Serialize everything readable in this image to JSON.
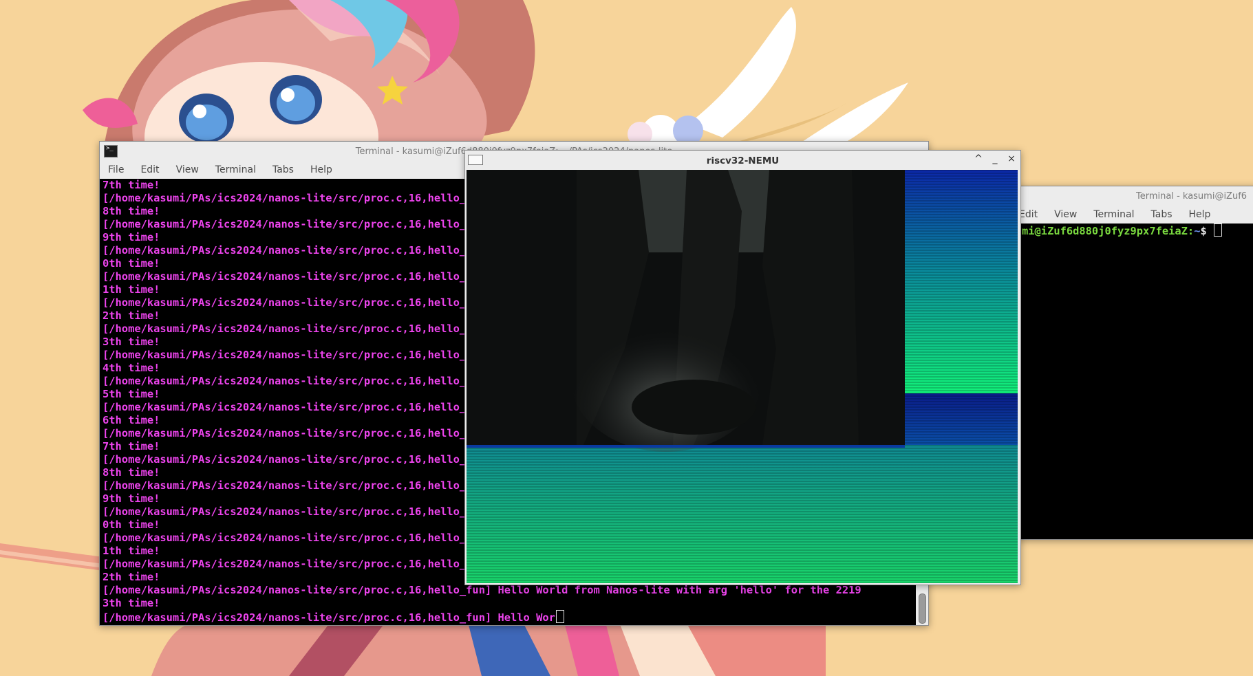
{
  "left_terminal": {
    "title": "Terminal - kasumi@iZuf6d880j0fyz9px7feiaZ: ~/PAs/ics2024/nanos-lite",
    "menu": [
      "File",
      "Edit",
      "View",
      "Terminal",
      "Tabs",
      "Help"
    ],
    "lines": [
      "7th time!",
      "[/home/kasumi/PAs/ics2024/nanos-lite/src/proc.c,16,hello_fun] Hello World from Nanos-lite with arg 'hello' for the 2198th time!",
      "8th time!",
      "[/home/kasumi/PAs/ics2024/nanos-lite/src/proc.c,16,hello_fun] Hello World from Nanos-lite with arg 'hello' for the 2199th time!",
      "9th time!",
      "[/home/kasumi/PAs/ics2024/nanos-lite/src/proc.c,16,hello_fun] Hello World from Nanos-lite with arg 'hello' for the 2200th time!",
      "0th time!",
      "[/home/kasumi/PAs/ics2024/nanos-lite/src/proc.c,16,hello_fun] Hello World from Nanos-lite with arg 'hello' for the 2201th time!",
      "1th time!",
      "[/home/kasumi/PAs/ics2024/nanos-lite/src/proc.c,16,hello_fun] Hello World from Nanos-lite with arg 'hello' for the 2202th time!",
      "2th time!",
      "[/home/kasumi/PAs/ics2024/nanos-lite/src/proc.c,16,hello_fun] Hello World from Nanos-lite with arg 'hello' for the 2203th time!",
      "3th time!",
      "[/home/kasumi/PAs/ics2024/nanos-lite/src/proc.c,16,hello_fun] Hello World from Nanos-lite with arg 'hello' for the 2204th time!",
      "4th time!",
      "[/home/kasumi/PAs/ics2024/nanos-lite/src/proc.c,16,hello_fun] Hello World from Nanos-lite with arg 'hello' for the 2205th time!",
      "5th time!",
      "[/home/kasumi/PAs/ics2024/nanos-lite/src/proc.c,16,hello_fun] Hello World from Nanos-lite with arg 'hello' for the 2206th time!",
      "6th time!",
      "[/home/kasumi/PAs/ics2024/nanos-lite/src/proc.c,16,hello_fun] Hello World from Nanos-lite with arg 'hello' for the 2207th time!",
      "7th time!",
      "[/home/kasumi/PAs/ics2024/nanos-lite/src/proc.c,16,hello_fun] Hello World from Nanos-lite with arg 'hello' for the 2208th time!",
      "8th time!",
      "[/home/kasumi/PAs/ics2024/nanos-lite/src/proc.c,16,hello_fun] Hello World from Nanos-lite with arg 'hello' for the 2209th time!",
      "9th time!",
      "[/home/kasumi/PAs/ics2024/nanos-lite/src/proc.c,16,hello_fun] Hello World from Nanos-lite with arg 'hello' for the 2210th time!",
      "0th time!",
      "[/home/kasumi/PAs/ics2024/nanos-lite/src/proc.c,16,hello_fun] Hello World from Nanos-lite with arg 'hello' for the 2211th time!",
      "1th time!",
      "[/home/kasumi/PAs/ics2024/nanos-lite/src/proc.c,16,hello_fun] Hello World from Nanos-lite with arg 'hello' for the 2212th time!",
      "2th time!",
      "[/home/kasumi/PAs/ics2024/nanos-lite/src/proc.c,16,hello_fun] Hello World from Nanos-lite with arg 'hello' for the 2219",
      "3th time!"
    ],
    "last_line": "[/home/kasumi/PAs/ics2024/nanos-lite/src/proc.c,16,hello_fun] Hello Wor",
    "text_color": "#ee44ee"
  },
  "right_terminal": {
    "title": "Terminal - kasumi@iZuf6",
    "menu": [
      "Edit",
      "View",
      "Terminal",
      "Tabs",
      "Help"
    ],
    "prompt_user": "mi@iZuf6d880j0fyz9px7feiaZ:",
    "prompt_path": "~",
    "prompt_symbol": "$",
    "prompt_color": "#7ad93f"
  },
  "nemu": {
    "title": "riscv32-NEMU",
    "buttons": [
      "^",
      "_",
      "×"
    ]
  },
  "icons": {
    "terminal": "terminal-icon",
    "nemu": "window-icon"
  }
}
